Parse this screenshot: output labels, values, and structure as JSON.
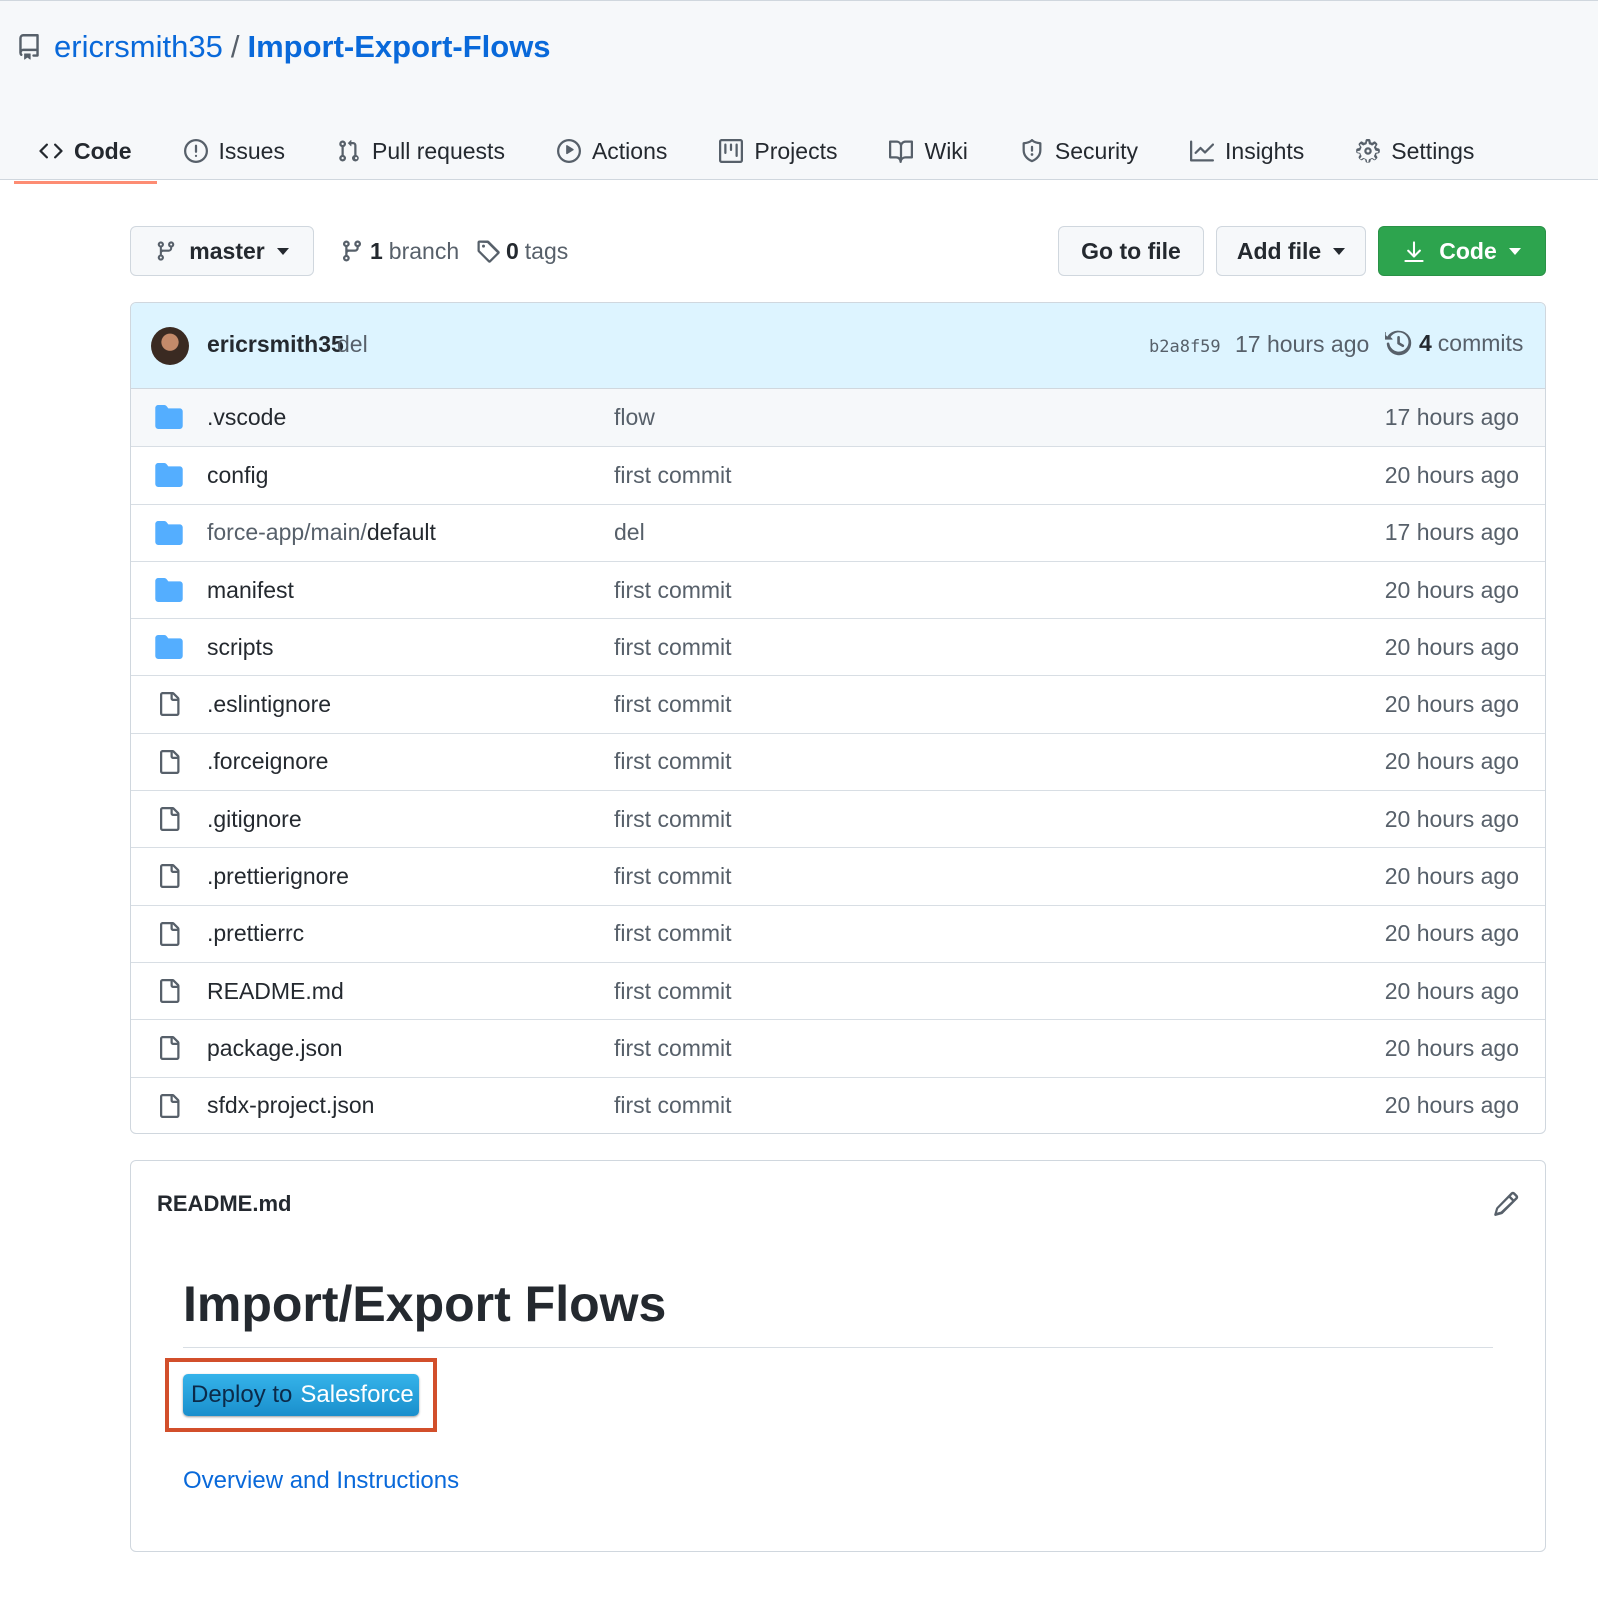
{
  "repo": {
    "owner": "ericrsmith35",
    "separator": "/",
    "name": "Import-Export-Flows"
  },
  "tabs": [
    {
      "label": "Code",
      "icon": "code-icon",
      "active": true
    },
    {
      "label": "Issues",
      "icon": "issue-icon"
    },
    {
      "label": "Pull requests",
      "icon": "pull-request-icon"
    },
    {
      "label": "Actions",
      "icon": "play-icon"
    },
    {
      "label": "Projects",
      "icon": "project-icon"
    },
    {
      "label": "Wiki",
      "icon": "book-icon"
    },
    {
      "label": "Security",
      "icon": "shield-icon"
    },
    {
      "label": "Insights",
      "icon": "graph-icon"
    },
    {
      "label": "Settings",
      "icon": "gear-icon"
    }
  ],
  "toolbar": {
    "branch_name": "master",
    "branch_count": "1",
    "branch_label": "branch",
    "tag_count": "0",
    "tag_label": "tags",
    "go_to_file": "Go to file",
    "add_file": "Add file",
    "code": "Code"
  },
  "latest_commit": {
    "author": "ericrsmith35",
    "message": "del",
    "sha": "b2a8f59",
    "time": "17 hours ago",
    "commit_count": "4",
    "commit_label": "commits"
  },
  "files": [
    {
      "type": "dir",
      "name": ".vscode",
      "message": "flow",
      "time": "17 hours ago"
    },
    {
      "type": "dir",
      "name": "config",
      "message": "first commit",
      "time": "20 hours ago"
    },
    {
      "type": "dir",
      "name_dim": "force-app/main/",
      "name": "default",
      "message": "del",
      "time": "17 hours ago"
    },
    {
      "type": "dir",
      "name": "manifest",
      "message": "first commit",
      "time": "20 hours ago"
    },
    {
      "type": "dir",
      "name": "scripts",
      "message": "first commit",
      "time": "20 hours ago"
    },
    {
      "type": "file",
      "name": ".eslintignore",
      "message": "first commit",
      "time": "20 hours ago"
    },
    {
      "type": "file",
      "name": ".forceignore",
      "message": "first commit",
      "time": "20 hours ago"
    },
    {
      "type": "file",
      "name": ".gitignore",
      "message": "first commit",
      "time": "20 hours ago"
    },
    {
      "type": "file",
      "name": ".prettierignore",
      "message": "first commit",
      "time": "20 hours ago"
    },
    {
      "type": "file",
      "name": ".prettierrc",
      "message": "first commit",
      "time": "20 hours ago"
    },
    {
      "type": "file",
      "name": "README.md",
      "message": "first commit",
      "time": "20 hours ago"
    },
    {
      "type": "file",
      "name": "package.json",
      "message": "first commit",
      "time": "20 hours ago"
    },
    {
      "type": "file",
      "name": "sfdx-project.json",
      "message": "first commit",
      "time": "20 hours ago"
    }
  ],
  "readme": {
    "filename": "README.md",
    "heading": "Import/Export Flows",
    "deploy_part1": "Deploy to",
    "deploy_part2": "Salesforce",
    "link": "Overview and Instructions"
  },
  "colors": {
    "accent_link": "#0969da",
    "code_button": "#2da44e",
    "active_tab_underline": "#fd8c73",
    "folder": "#54aeff",
    "highlight_box": "#d24f2b",
    "deploy_button": "#1a8fcc"
  }
}
